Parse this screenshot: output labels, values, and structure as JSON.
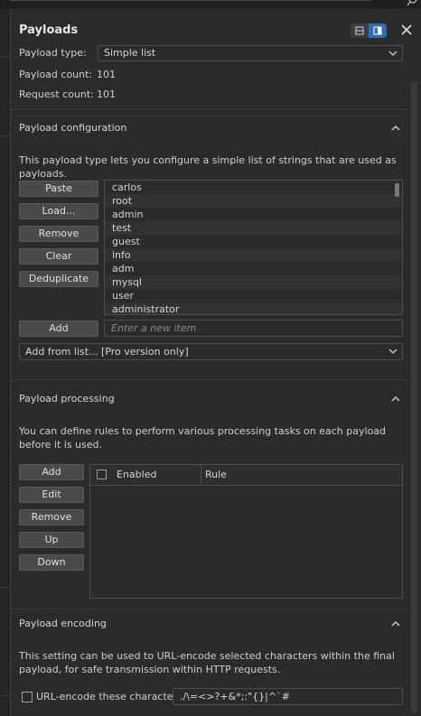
{
  "header": {
    "title": "Payloads"
  },
  "payload_type": {
    "label": "Payload type:",
    "value": "Simple list"
  },
  "payload_count": {
    "label": "Payload count:",
    "value": "101"
  },
  "request_count": {
    "label": "Request count:",
    "value": "101"
  },
  "configuration": {
    "title": "Payload configuration",
    "description": "This payload type lets you configure a simple list of strings that are used as payloads.",
    "buttons": {
      "paste": "Paste",
      "load": "Load...",
      "remove": "Remove",
      "clear": "Clear",
      "deduplicate": "Deduplicate",
      "add": "Add"
    },
    "items": [
      "carlos",
      "root",
      "admin",
      "test",
      "guest",
      "info",
      "adm",
      "mysql",
      "user",
      "administrator"
    ],
    "add_placeholder": "Enter a new item",
    "add_from_list": "Add from list... [Pro version only]"
  },
  "processing": {
    "title": "Payload processing",
    "description": "You can define rules to perform various processing tasks on each payload before it is used.",
    "buttons": {
      "add": "Add",
      "edit": "Edit",
      "remove": "Remove",
      "up": "Up",
      "down": "Down"
    },
    "columns": {
      "enabled": "Enabled",
      "rule": "Rule"
    }
  },
  "encoding": {
    "title": "Payload encoding",
    "description": "This setting can be used to URL-encode selected characters within the final payload, for safe transmission within HTTP requests.",
    "checkbox_label": "URL-encode these characters:",
    "characters": "./\\=<>?+&*;:\"{}|^`#"
  },
  "colors": {
    "accent": "#2f6fb0",
    "background": "#2b2b2b",
    "button": "#4a4a4a"
  }
}
